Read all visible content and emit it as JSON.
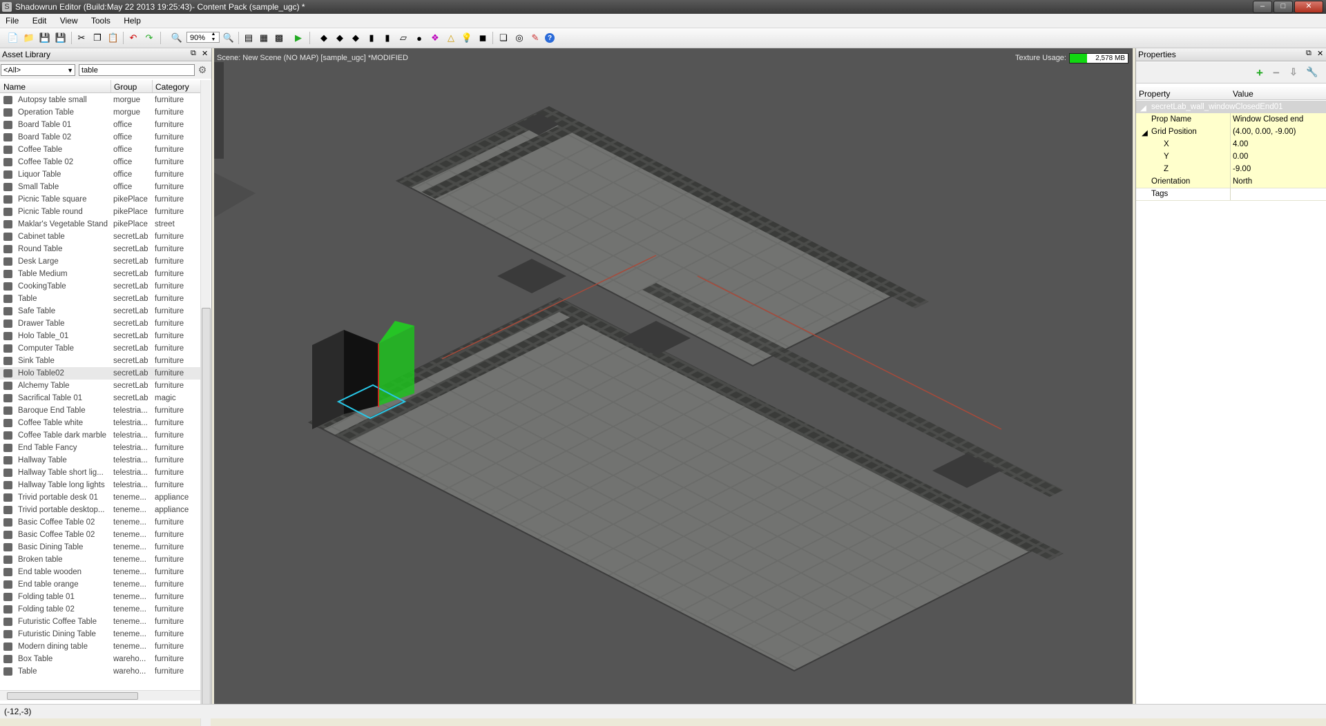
{
  "window": {
    "title": "Shadowrun Editor (Build:May 22 2013 19:25:43)- Content Pack (sample_ugc) *"
  },
  "menu": [
    "File",
    "Edit",
    "View",
    "Tools",
    "Help"
  ],
  "toolbar": {
    "zoom": "90%"
  },
  "asset_library": {
    "title": "Asset Library",
    "filter": "<All>",
    "search": "table",
    "columns": [
      "Name",
      "Group",
      "Category"
    ],
    "rows": [
      {
        "name": "Autopsy table small",
        "group": "morgue",
        "category": "furniture"
      },
      {
        "name": "Operation Table",
        "group": "morgue",
        "category": "furniture"
      },
      {
        "name": "Board Table 01",
        "group": "office",
        "category": "furniture"
      },
      {
        "name": "Board Table 02",
        "group": "office",
        "category": "furniture"
      },
      {
        "name": "Coffee Table",
        "group": "office",
        "category": "furniture"
      },
      {
        "name": "Coffee Table 02",
        "group": "office",
        "category": "furniture"
      },
      {
        "name": "Liquor Table",
        "group": "office",
        "category": "furniture"
      },
      {
        "name": "Small Table",
        "group": "office",
        "category": "furniture"
      },
      {
        "name": "Picnic Table square",
        "group": "pikePlace",
        "category": "furniture"
      },
      {
        "name": "Picnic Table round",
        "group": "pikePlace",
        "category": "furniture"
      },
      {
        "name": "Maklar's Vegetable Stand",
        "group": "pikePlace",
        "category": "street"
      },
      {
        "name": "Cabinet table",
        "group": "secretLab",
        "category": "furniture"
      },
      {
        "name": "Round Table",
        "group": "secretLab",
        "category": "furniture"
      },
      {
        "name": "Desk Large",
        "group": "secretLab",
        "category": "furniture"
      },
      {
        "name": "Table Medium",
        "group": "secretLab",
        "category": "furniture"
      },
      {
        "name": "CookingTable",
        "group": "secretLab",
        "category": "furniture"
      },
      {
        "name": "Table",
        "group": "secretLab",
        "category": "furniture"
      },
      {
        "name": "Safe Table",
        "group": "secretLab",
        "category": "furniture"
      },
      {
        "name": "Drawer Table",
        "group": "secretLab",
        "category": "furniture"
      },
      {
        "name": "Holo Table_01",
        "group": "secretLab",
        "category": "furniture"
      },
      {
        "name": "Computer Table",
        "group": "secretLab",
        "category": "furniture"
      },
      {
        "name": "Sink Table",
        "group": "secretLab",
        "category": "furniture"
      },
      {
        "name": "Holo Table02",
        "group": "secretLab",
        "category": "furniture",
        "selected": true
      },
      {
        "name": "Alchemy Table",
        "group": "secretLab",
        "category": "furniture"
      },
      {
        "name": "Sacrifical Table 01",
        "group": "secretLab",
        "category": "magic"
      },
      {
        "name": "Baroque End Table",
        "group": "telestria...",
        "category": "furniture"
      },
      {
        "name": "Coffee Table white",
        "group": "telestria...",
        "category": "furniture"
      },
      {
        "name": "Coffee Table dark marble",
        "group": "telestria...",
        "category": "furniture"
      },
      {
        "name": "End Table Fancy",
        "group": "telestria...",
        "category": "furniture"
      },
      {
        "name": "Hallway Table",
        "group": "telestria...",
        "category": "furniture"
      },
      {
        "name": "Hallway Table short lig...",
        "group": "telestria...",
        "category": "furniture"
      },
      {
        "name": "Hallway Table long lights",
        "group": "telestria...",
        "category": "furniture"
      },
      {
        "name": "Trivid portable desk 01",
        "group": "teneme...",
        "category": "appliance"
      },
      {
        "name": "Trivid portable desktop...",
        "group": "teneme...",
        "category": "appliance"
      },
      {
        "name": "Basic Coffee Table 02",
        "group": "teneme...",
        "category": "furniture"
      },
      {
        "name": "Basic Coffee Table 02",
        "group": "teneme...",
        "category": "furniture"
      },
      {
        "name": "Basic Dining Table",
        "group": "teneme...",
        "category": "furniture"
      },
      {
        "name": "Broken table",
        "group": "teneme...",
        "category": "furniture"
      },
      {
        "name": "End table wooden",
        "group": "teneme...",
        "category": "furniture"
      },
      {
        "name": "End table orange",
        "group": "teneme...",
        "category": "furniture"
      },
      {
        "name": "Folding table 01",
        "group": "teneme...",
        "category": "furniture"
      },
      {
        "name": "Folding table 02",
        "group": "teneme...",
        "category": "furniture"
      },
      {
        "name": "Futuristic Coffee Table",
        "group": "teneme...",
        "category": "furniture"
      },
      {
        "name": "Futuristic Dining Table",
        "group": "teneme...",
        "category": "furniture"
      },
      {
        "name": "Modern dining table",
        "group": "teneme...",
        "category": "furniture"
      },
      {
        "name": "Box Table",
        "group": "wareho...",
        "category": "furniture"
      },
      {
        "name": "Table",
        "group": "wareho...",
        "category": "furniture"
      }
    ]
  },
  "viewport": {
    "scene_label": "Scene: New Scene (NO MAP) [sample_ugc] *MODIFIED",
    "texture_label": "Texture Usage:",
    "texture_value": "2,578 MB",
    "texture_fraction": 0.3
  },
  "properties": {
    "title": "Properties",
    "columns": [
      "Property",
      "Value"
    ],
    "object_name": "secretLab_wall_windowClosedEnd01",
    "rows": [
      {
        "key": "Prop Name",
        "value": "Window Closed end"
      },
      {
        "key": "Grid Position",
        "value": "(4.00, 0.00, -9.00)"
      },
      {
        "key": "X",
        "value": "4.00"
      },
      {
        "key": "Y",
        "value": "0.00"
      },
      {
        "key": "Z",
        "value": "-9.00"
      },
      {
        "key": "Orientation",
        "value": "North"
      },
      {
        "key": "Tags",
        "value": ""
      }
    ]
  },
  "status": {
    "coords": "(-12,-3)"
  }
}
